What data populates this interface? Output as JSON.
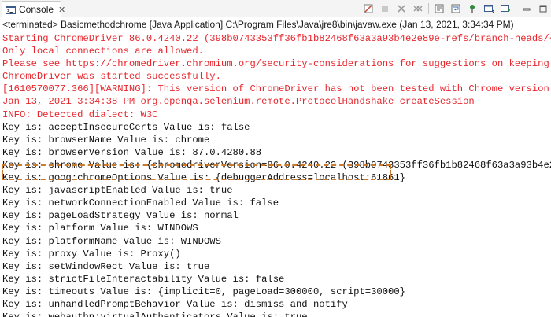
{
  "tab": {
    "label": "Console",
    "close_glyph": "✕"
  },
  "status": "<terminated> Basicmethodchrome [Java Application] C:\\Program Files\\Java\\jre8\\bin\\javaw.exe (Jan 13, 2021, 3:34:34 PM)",
  "toolbar": {
    "icons": [
      "clear-console-icon",
      "terminate-icon",
      "remove-launch-icon",
      "scroll-lock-icon",
      "word-wrap-icon",
      "pin-console-icon",
      "display-console-icon",
      "open-console-icon",
      "minimize-icon",
      "maximize-icon"
    ]
  },
  "colors": {
    "stderr": "#e8262d",
    "stdout": "#111111",
    "highlight": "#c97a2a"
  },
  "output": {
    "lines": [
      {
        "text": "Starting ChromeDriver 86.0.4240.22 (398b0743353ff36fb1b82468f63a3a93b4e2e89e-refs/branch-heads/4240@",
        "stream": "err"
      },
      {
        "text": "Only local connections are allowed.",
        "stream": "err"
      },
      {
        "text": "Please see https://chromedriver.chromium.org/security-considerations for suggestions on keeping Chro",
        "stream": "err"
      },
      {
        "text": "ChromeDriver was started successfully.",
        "stream": "err"
      },
      {
        "text": "[1610570077.366][WARNING]: This version of ChromeDriver has not been tested with Chrome version 87.",
        "stream": "err"
      },
      {
        "text": "Jan 13, 2021 3:34:38 PM org.openqa.selenium.remote.ProtocolHandshake createSession",
        "stream": "err"
      },
      {
        "text": "INFO: Detected dialect: W3C",
        "stream": "err"
      },
      {
        "text": "Key is: acceptInsecureCerts Value is: false",
        "stream": "out"
      },
      {
        "text": "Key is: browserName Value is: chrome",
        "stream": "out"
      },
      {
        "text": "Key is: browserVersion Value is: 87.0.4280.88",
        "stream": "out"
      },
      {
        "text": "Key is: chrome Value is: {chromedriverVersion=86.0.4240.22 (398b0743353ff36fb1b82468f63a3a93b4e2e89e",
        "stream": "out"
      },
      {
        "text": "Key is: goog:chromeOptions Value is: {debuggerAddress=localhost:61861}",
        "stream": "out"
      },
      {
        "text": "Key is: javascriptEnabled Value is: true",
        "stream": "out"
      },
      {
        "text": "Key is: networkConnectionEnabled Value is: false",
        "stream": "out"
      },
      {
        "text": "Key is: pageLoadStrategy Value is: normal",
        "stream": "out"
      },
      {
        "text": "Key is: platform Value is: WINDOWS",
        "stream": "out"
      },
      {
        "text": "Key is: platformName Value is: WINDOWS",
        "stream": "out"
      },
      {
        "text": "Key is: proxy Value is: Proxy()",
        "stream": "out"
      },
      {
        "text": "Key is: setWindowRect Value is: true",
        "stream": "out"
      },
      {
        "text": "Key is: strictFileInteractability Value is: false",
        "stream": "out"
      },
      {
        "text": "Key is: timeouts Value is: {implicit=0, pageLoad=300000, script=30000}",
        "stream": "out"
      },
      {
        "text": "Key is: unhandledPromptBehavior Value is: dismiss and notify",
        "stream": "out"
      },
      {
        "text": "Key is: webauthn:virtualAuthenticators Value is: true",
        "stream": "out"
      }
    ]
  }
}
